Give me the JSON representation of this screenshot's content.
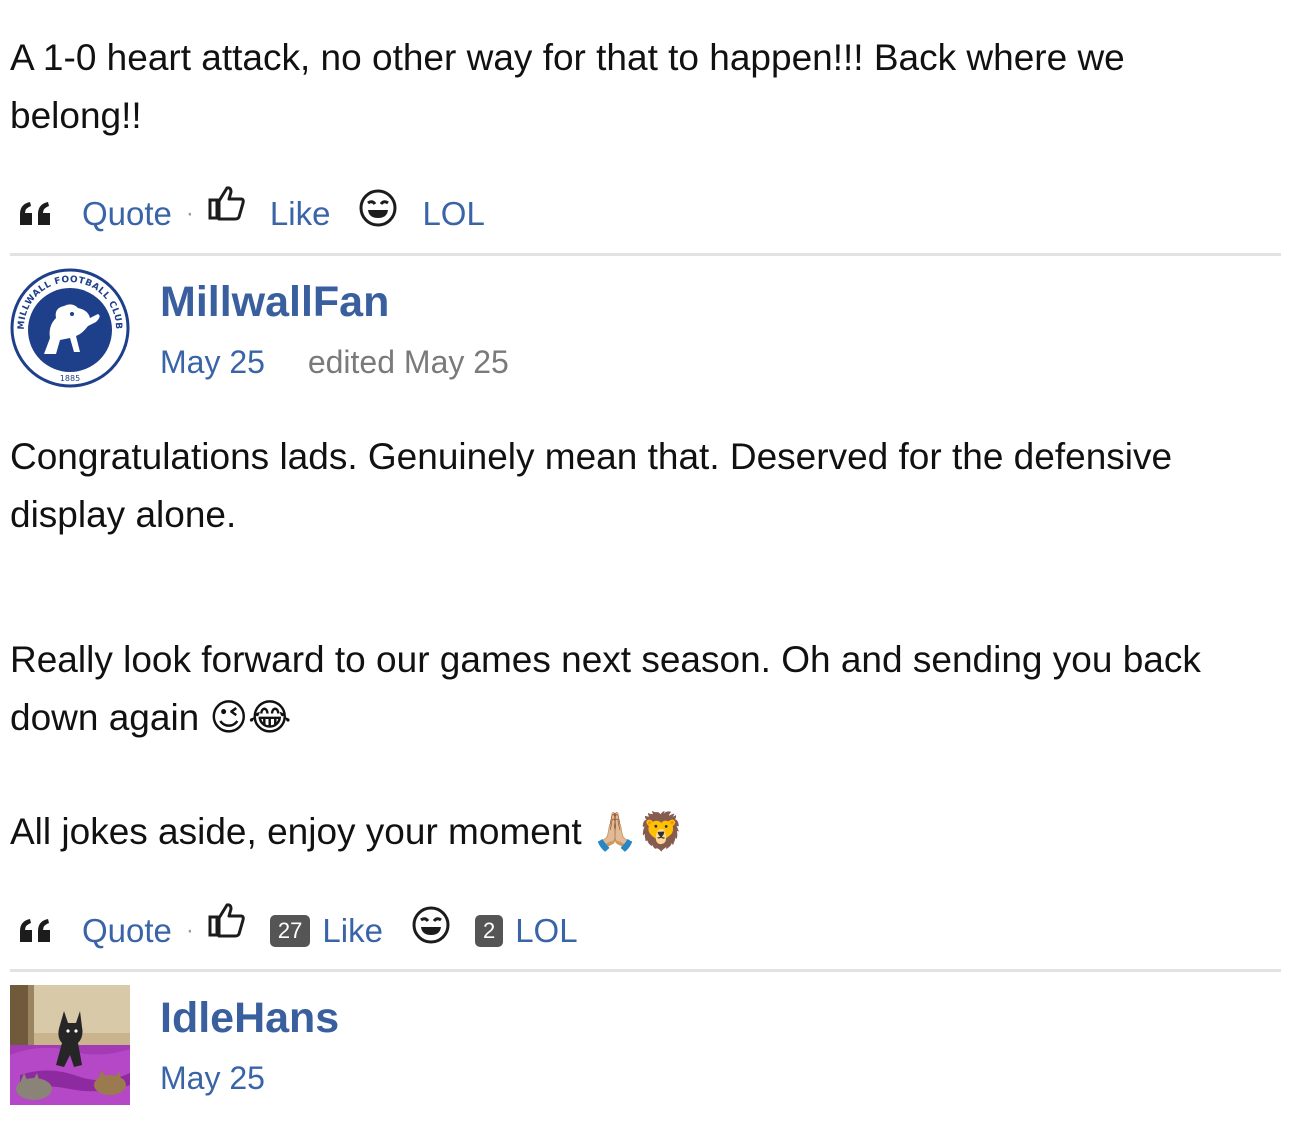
{
  "post_prev": {
    "body": "A 1-0 heart attack, no other way for that to happen!!! Back where we belong!!",
    "reactions": {
      "quote_label": "Quote",
      "separator": "·",
      "like_label": "Like",
      "lol_label": "LOL"
    }
  },
  "post_millwall": {
    "author": "MillwallFan",
    "date": "May 25",
    "edited": "edited May 25",
    "avatar": {
      "arc_text": "MILLWALL FOOTBALL CLUB",
      "year": "1885"
    },
    "paragraph1": "Congratulations lads. Genuinely mean that. Deserved for the defensive display alone.",
    "paragraph2_text": "Really look forward to our games next season. Oh and sending you back down again",
    "paragraph2_emojis": "😉😂",
    "paragraph3_text": "All jokes aside, enjoy your moment",
    "paragraph3_emojis": "🙏🏼🦁",
    "reactions": {
      "quote_label": "Quote",
      "separator": "·",
      "like_count": "27",
      "like_label": "Like",
      "lol_count": "2",
      "lol_label": "LOL"
    }
  },
  "post_idlehans": {
    "author": "IdleHans",
    "date": "May 25"
  },
  "colors": {
    "link_blue": "#3a64a8",
    "author_blue": "#3a5f9e",
    "badge_gray": "#555555",
    "millwall_navy": "#1e3f8a"
  }
}
